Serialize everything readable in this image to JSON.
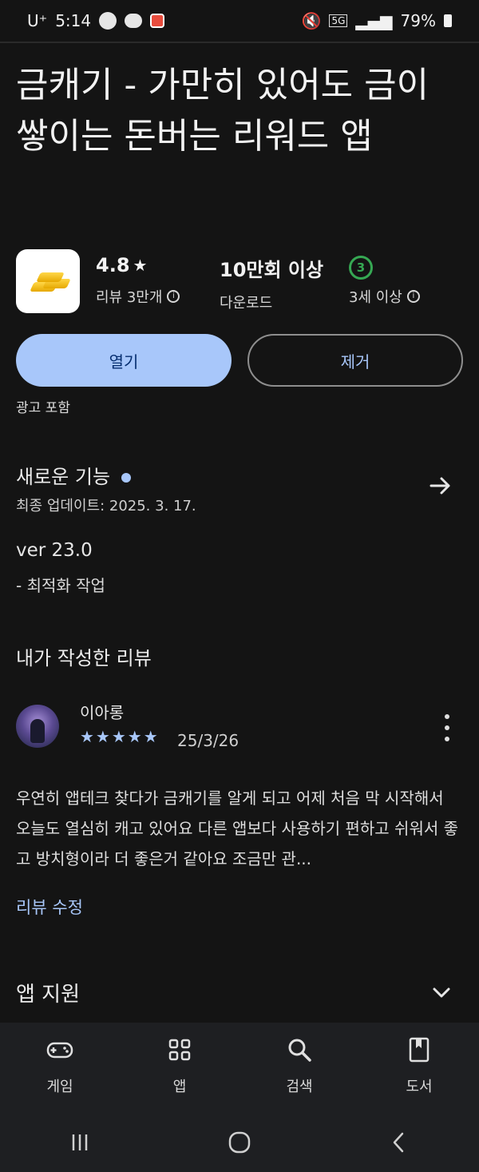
{
  "status_bar": {
    "carrier": "U⁺",
    "time": "5:14",
    "network": "5G",
    "battery": "79%"
  },
  "app": {
    "title": "금캐기 - 가만히 있어도 금이 쌓이는 돈버는 리워드 앱",
    "rating": "4.8",
    "reviews_label": "리뷰 3만개",
    "downloads": "10만회 이상",
    "downloads_label": "다운로드",
    "age_rating": "3",
    "age_label": "3세 이상",
    "open_button": "열기",
    "remove_button": "제거",
    "ads_label": "광고 포함"
  },
  "whats_new": {
    "title": "새로운 기능",
    "last_updated": "최종 업데이트: 2025. 3. 17.",
    "version": "ver 23.0",
    "note": "- 최적화 작업"
  },
  "my_review": {
    "title": "내가 작성한 리뷰",
    "author": "이아롱",
    "stars": "★★★★★",
    "rating": 5,
    "date": "25/3/26",
    "text": "우연히 앱테크 찾다가 금캐기를 알게 되고 어제 처음 막 시작해서 오늘도 열심히 캐고 있어요 다른 앱보다 사용하기 편하고 쉬워서 좋고 방치형이라 더 좋은거 같아요 조금만 관...",
    "edit_label": "리뷰 수정"
  },
  "app_support": {
    "title": "앱 지원"
  },
  "bottom_nav": [
    {
      "label": "게임",
      "icon": "gamepad-icon"
    },
    {
      "label": "앱",
      "icon": "apps-grid-icon"
    },
    {
      "label": "검색",
      "icon": "search-icon"
    },
    {
      "label": "도서",
      "icon": "book-icon"
    }
  ],
  "colors": {
    "background": "#141414",
    "accent": "#a8c7fa",
    "age_badge": "#36a853"
  }
}
